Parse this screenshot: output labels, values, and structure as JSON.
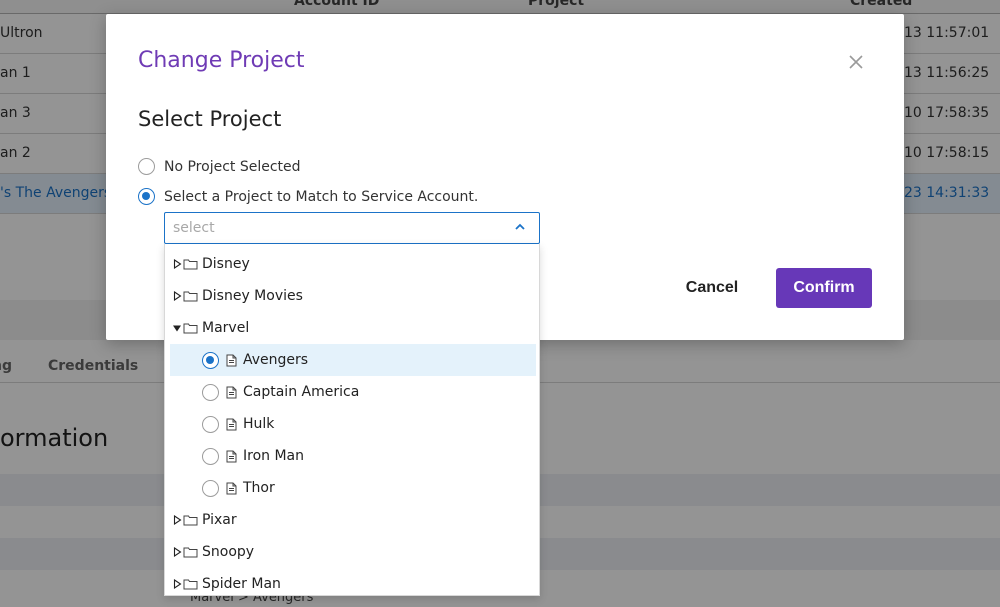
{
  "background": {
    "columns": {
      "account_id": "Account ID",
      "project": "Project",
      "created": "Created"
    },
    "rows": [
      {
        "name": "Ultron",
        "created": "13 11:57:01"
      },
      {
        "name": "an 1",
        "created": "13 11:56:25"
      },
      {
        "name": "an 3",
        "created": "10 17:58:35"
      },
      {
        "name": "an 2",
        "created": "10 17:58:15"
      },
      {
        "name": "'s The Avengers",
        "created": "23 14:31:33"
      }
    ],
    "tabs": {
      "tab_partial": "ng",
      "credentials": "Credentials"
    },
    "section_title": "ormation",
    "project_path": "Marvel > Avengers"
  },
  "modal": {
    "title": "Change Project",
    "section_title": "Select Project",
    "options": {
      "no_project": "No Project Selected",
      "select_project": "Select a Project to Match to Service Account."
    },
    "select_placeholder": "select",
    "cancel_label": "Cancel",
    "confirm_label": "Confirm"
  },
  "tree": {
    "folders": {
      "disney": "Disney",
      "disney_movies": "Disney Movies",
      "marvel": "Marvel",
      "pixar": "Pixar",
      "snoopy": "Snoopy",
      "spider_man": "Spider Man"
    },
    "projects": {
      "avengers": "Avengers",
      "captain_america": "Captain America",
      "hulk": "Hulk",
      "iron_man": "Iron Man",
      "thor": "Thor"
    },
    "selected_project": "Avengers"
  },
  "colors": {
    "accent_purple": "#6738b8",
    "title_purple": "#6f3bb5",
    "selection_blue": "#1b73c8",
    "selected_row_bg": "#e4f2fb"
  },
  "icons": [
    "close-icon",
    "chevron-up-icon",
    "caret-right-icon",
    "caret-down-icon",
    "folder-icon",
    "document-icon"
  ]
}
